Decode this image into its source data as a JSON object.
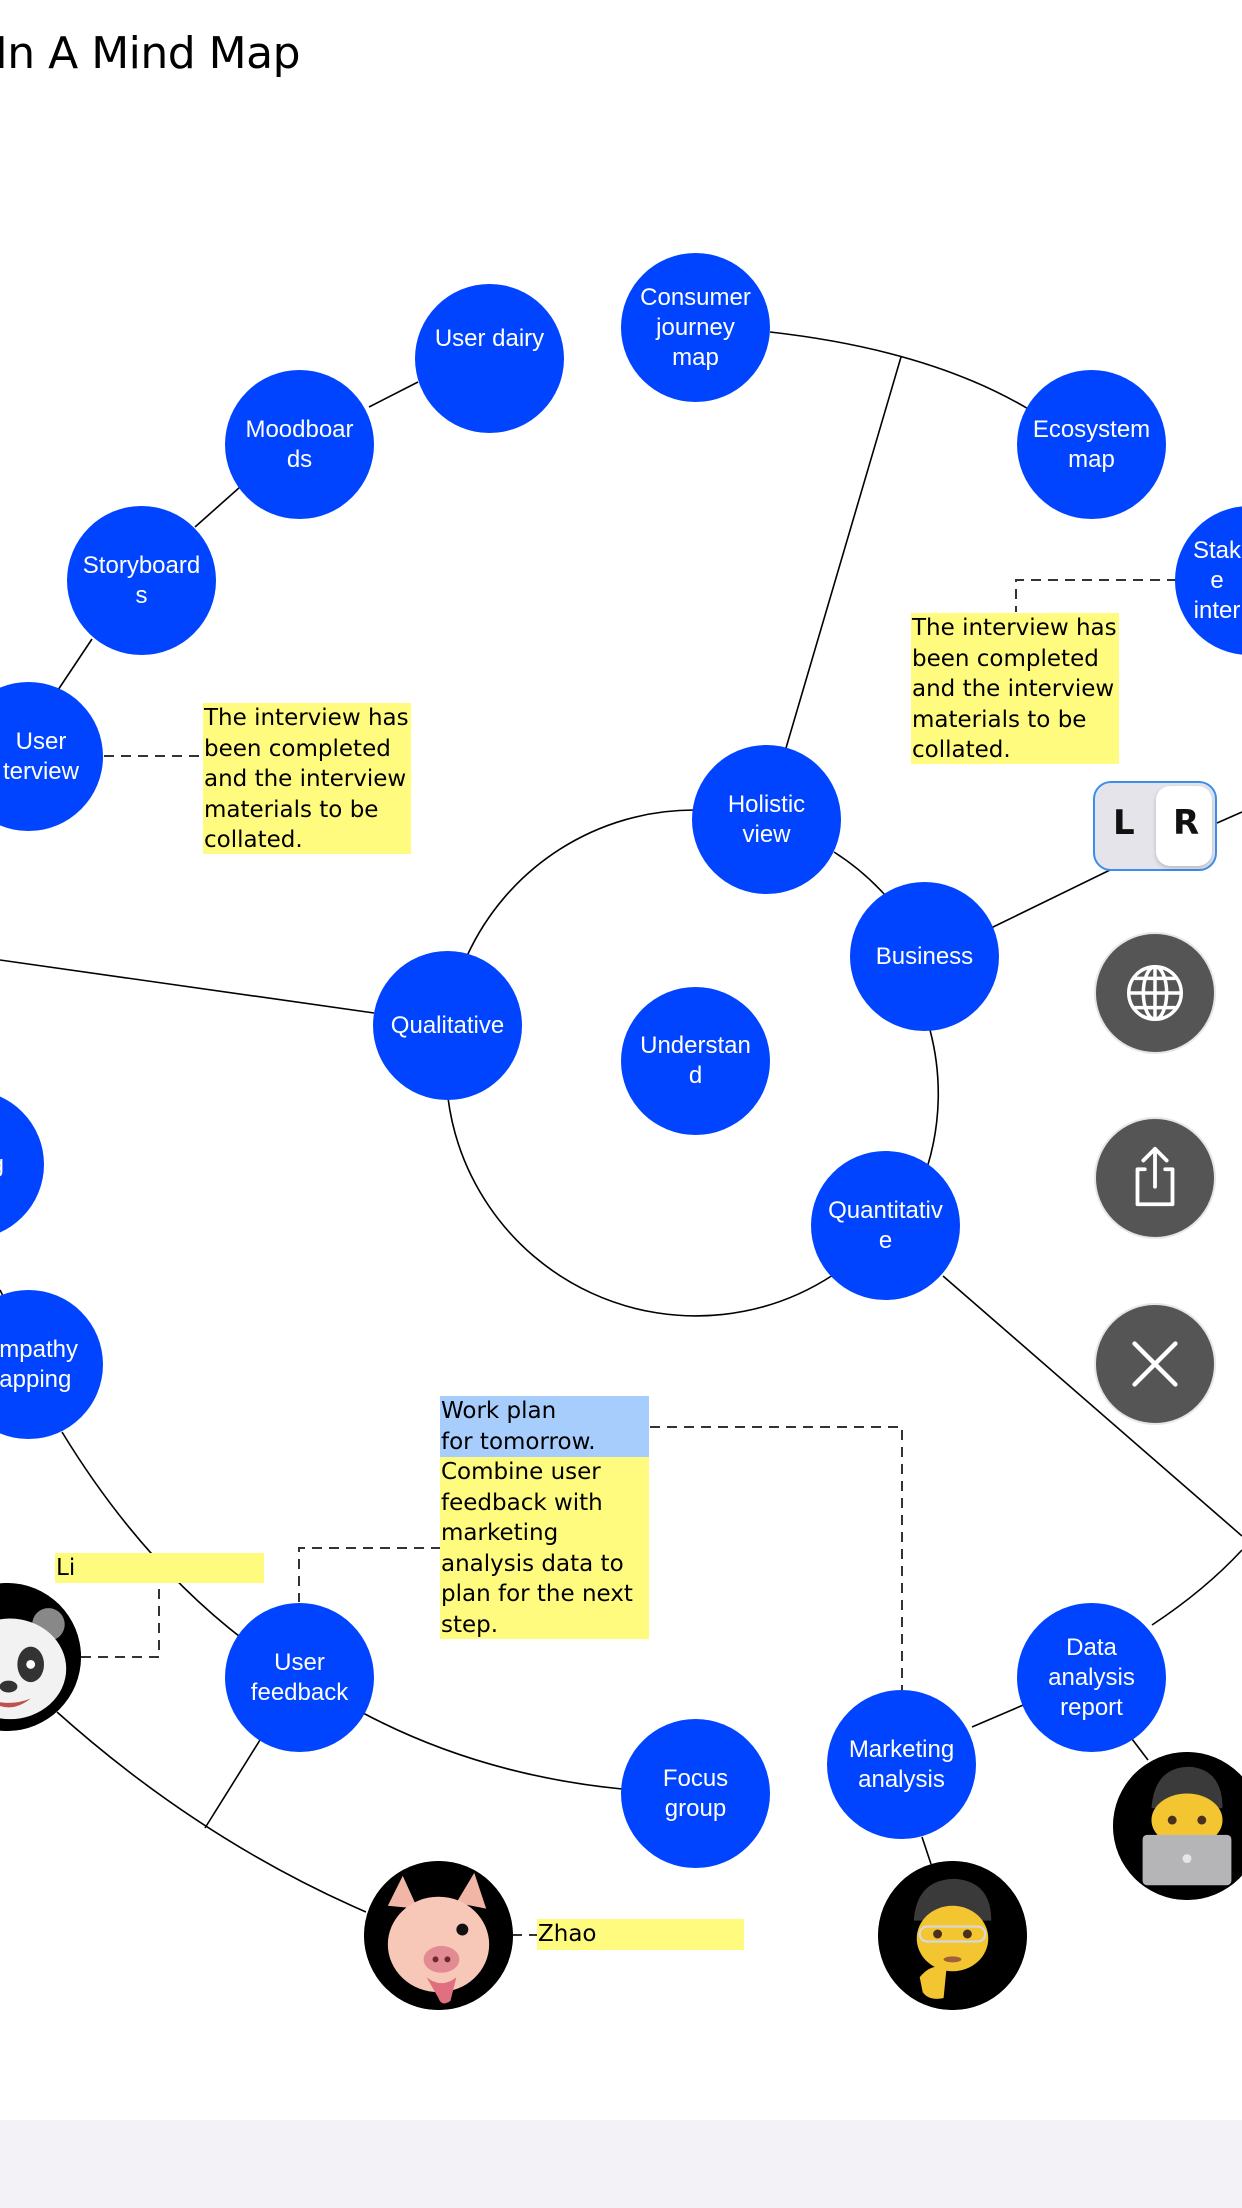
{
  "title": "Methods In A Mind Map",
  "title_visible": "ods In A Mind Map",
  "colors": {
    "node_fill": "#0044ff",
    "node_text": "#ffffff",
    "note_yellow": "#fffb7f",
    "note_blue": "#a7cdfd",
    "fab_fill": "#555555",
    "toggle_border": "#3a8ef0",
    "footer_bg": "#f2f2f7"
  },
  "nodes": {
    "understand": "Understan\nd",
    "holistic_view": "Holistic\nview",
    "business": "Business",
    "qualitative": "Qualitative",
    "quantitative": "Quantitativ\ne",
    "consumer_journey_map": "Consumer\njourney\nmap",
    "ecosystem_map": "Ecosystem\nmap",
    "stakeholder_interview": "Stak\ne\ninter",
    "user_dairy": "User dairy",
    "moodboards": "Moodboar\nds",
    "storyboards": "Storyboard\ns",
    "user_interview": "User\nterview",
    "left_partial_node": "g",
    "empathy_mapping": "mpathy\napping",
    "user_feedback": "User\nfeedback",
    "focus_group": "Focus\ngroup",
    "marketing_analysis": "Marketing\nanalysis",
    "data_analysis_report": "Data\nanalysis\nreport"
  },
  "notes": {
    "interview_note_left": "The interview has\nbeen completed\nand the interview\nmaterials to be\ncollated.",
    "interview_note_right": "The interview has\nbeen completed\nand the interview\nmaterials to be\ncollated.",
    "work_plan_header": "Work plan\nfor tomorrow.",
    "work_plan_body": "Combine user\nfeedback with\nmarketing\nanalysis data to\nplan for the next\nstep.",
    "li_label": "Li",
    "zhao_label": "Zhao"
  },
  "avatars": {
    "panda": "panda-avatar",
    "pig": "pig-avatar",
    "thinking_man": "thinking-memoji-avatar",
    "laptop_man": "laptop-memoji-avatar"
  },
  "toolbar": {
    "toggle_left": "L",
    "toggle_right": "R",
    "toggle_selected": "R",
    "language_button": "globe-icon",
    "share_button": "share-icon",
    "close_button": "close-icon"
  }
}
